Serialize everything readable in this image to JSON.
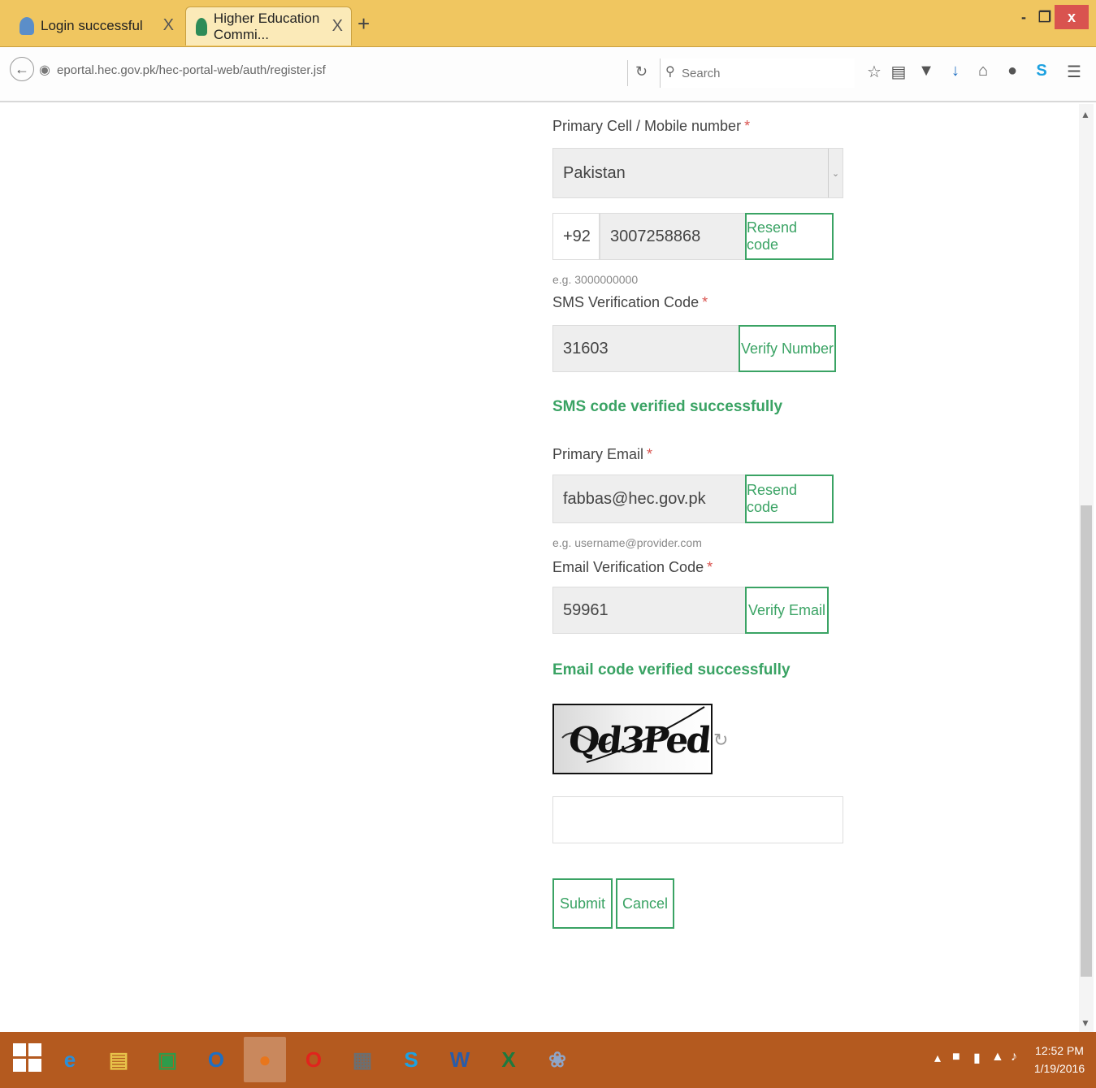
{
  "browser": {
    "tabs": [
      {
        "label": "Login successful"
      },
      {
        "label": "Higher Education Commi..."
      }
    ],
    "tab_close_glyph": "X",
    "new_tab_glyph": "+",
    "window_controls": {
      "minimize": "-",
      "restore": "❐",
      "close": "x"
    },
    "url": "eportal.hec.gov.pk/hec-portal-web/auth/register.jsf",
    "search_placeholder": "Search"
  },
  "form": {
    "mobile_label": "Primary Cell / Mobile number",
    "country_select_value": "Pakistan",
    "country_code": "+92",
    "phone_value": "3007258868",
    "resend_code_label": "Resend code",
    "phone_hint": "e.g. 3000000000",
    "sms_label": "SMS Verification Code",
    "sms_code_value": "31603",
    "verify_number_label": "Verify Number",
    "sms_success": "SMS code verified successfully",
    "email_label": "Primary Email",
    "email_value": "fabbas@hec.gov.pk",
    "email_resend_label": "Resend code",
    "email_hint": "e.g. username@provider.com",
    "email_code_label": "Email Verification Code",
    "email_code_value": "59961",
    "verify_email_label": "Verify Email",
    "email_success": "Email code verified successfully",
    "captcha_text": "Qd3Ped",
    "captcha_input_value": "",
    "submit_label": "Submit",
    "cancel_label": "Cancel",
    "required_mark": "*"
  },
  "taskbar": {
    "apps": [
      {
        "icon": "internet-explorer-icon",
        "glyph": "e",
        "color": "#2a8fd9"
      },
      {
        "icon": "file-explorer-icon",
        "glyph": "▤",
        "color": "#e8c34a"
      },
      {
        "icon": "store-icon",
        "glyph": "▣",
        "color": "#2e9b4a"
      },
      {
        "icon": "outlook-icon",
        "glyph": "O",
        "color": "#1f6fc2"
      },
      {
        "icon": "firefox-icon",
        "glyph": "●",
        "color": "#e8761c"
      },
      {
        "icon": "opera-icon",
        "glyph": "O",
        "color": "#e0241d"
      },
      {
        "icon": "calculator-icon",
        "glyph": "▦",
        "color": "#6e6e6e"
      },
      {
        "icon": "skype-icon",
        "glyph": "S",
        "color": "#1da1e0"
      },
      {
        "icon": "word-icon",
        "glyph": "W",
        "color": "#2a5ca8"
      },
      {
        "icon": "excel-icon",
        "glyph": "X",
        "color": "#1d7a3e"
      },
      {
        "icon": "paint-icon",
        "glyph": "❀",
        "color": "#8fa6c8"
      }
    ],
    "time": "12:52 PM",
    "date": "1/19/2016"
  }
}
